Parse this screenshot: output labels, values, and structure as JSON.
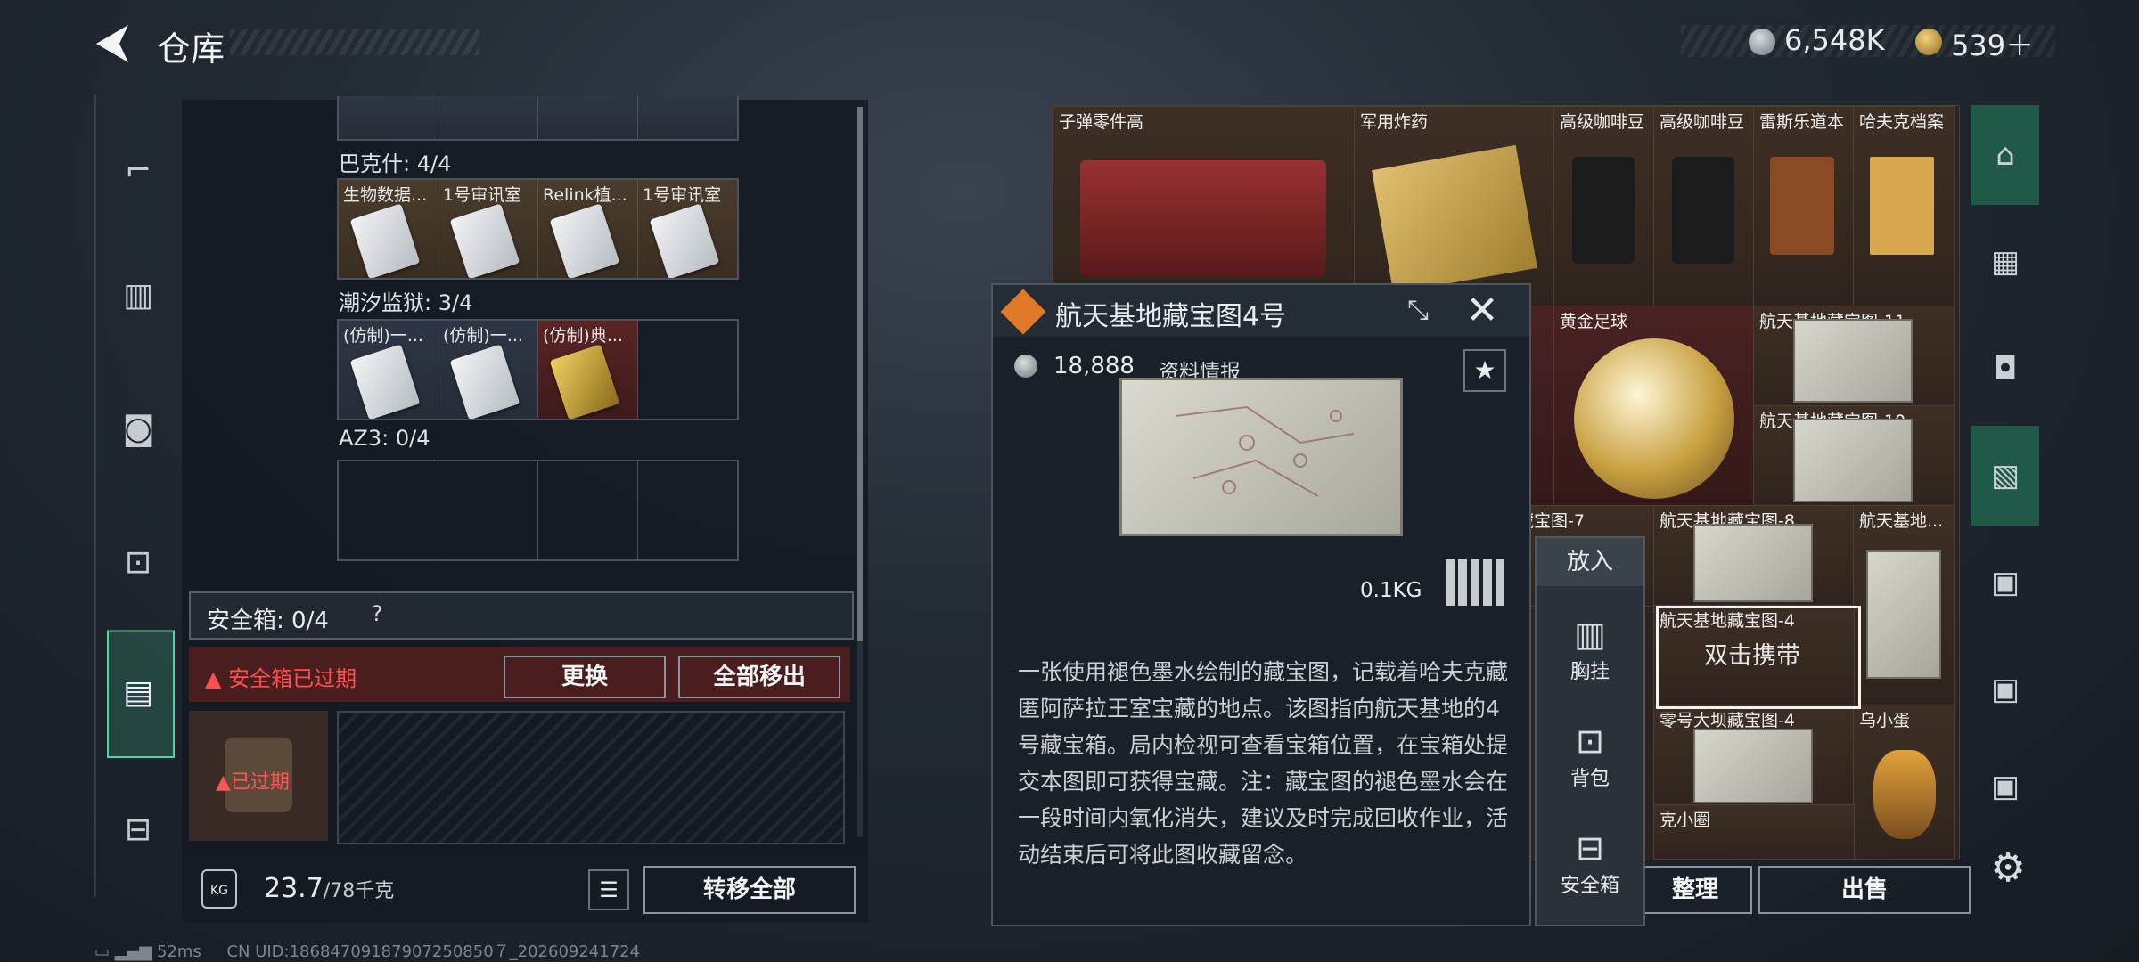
{
  "header": {
    "title": "仓库",
    "currency1": "6,548K",
    "currency2": "539＋"
  },
  "leftnav": {
    "icons": [
      "rifle-icon",
      "armor-vest-icon",
      "backpack-case-icon",
      "backpack-icon",
      "safebox-icon",
      "toolbox-icon"
    ]
  },
  "containers": {
    "group1": {
      "label": "巴克什: 4/4",
      "items": [
        "生物数据...",
        "1号审讯室",
        "Relink植...",
        "1号审讯室"
      ]
    },
    "group2": {
      "label": "潮汐监狱: 3/4",
      "items": [
        "(仿制)一...",
        "(仿制)一...",
        "(仿制)典..."
      ]
    },
    "group3": {
      "label": "AZ3: 0/4"
    },
    "safe_label": "安全箱: 0/4",
    "safe_help": "?",
    "expired_warning": "安全箱已过期",
    "swap_button": "更换",
    "move_all_button": "全部移出",
    "expired_tag": "已过期"
  },
  "footer": {
    "weight": "23.7",
    "weight_max": "/78千克",
    "kg_icon": "KG",
    "transfer_all": "转移全部"
  },
  "status": {
    "ping": "52ms",
    "uid": "CN UID:18684709187907250850７_202609241724"
  },
  "stash": {
    "items": [
      "子弹零件高",
      "军用炸药",
      "高级咖啡豆",
      "高级咖啡豆",
      "雷斯乐道本",
      "哈夫克档案",
      "黄金足球",
      "航天基地藏宝图-11",
      "航天基地藏宝图-10",
      "藏宝图-7",
      "航天基地藏宝图-8",
      "航天基地...",
      "航天基地藏宝图-4",
      "零号大坝藏宝图-4",
      "乌小蛋",
      "克小圈"
    ],
    "sort_button": "整理",
    "sell_button": "出售",
    "selected_hint": "双击携带"
  },
  "detail": {
    "title": "航天基地藏宝图4号",
    "price": "18,888",
    "category": "资料情报",
    "weight": "0.1KG",
    "description": "一张使用褪色墨水绘制的藏宝图，记载着哈夫克藏匿阿萨拉王室宝藏的地点。该图指向航天基地的4号藏宝箱。局内检视可查看宝箱位置，在宝箱处提交本图即可获得宝藏。注：藏宝图的褪色墨水会在一段时间内氧化消失，建议及时完成回收作业，活动结束后可将此图收藏留念。"
  },
  "putmenu": {
    "title": "放入",
    "items": [
      "胸挂",
      "背包",
      "安全箱"
    ]
  },
  "colors": {
    "accent_green": "#4fd6a0",
    "warning_red": "#ff4f4f",
    "brand_orange": "#e07a26"
  }
}
